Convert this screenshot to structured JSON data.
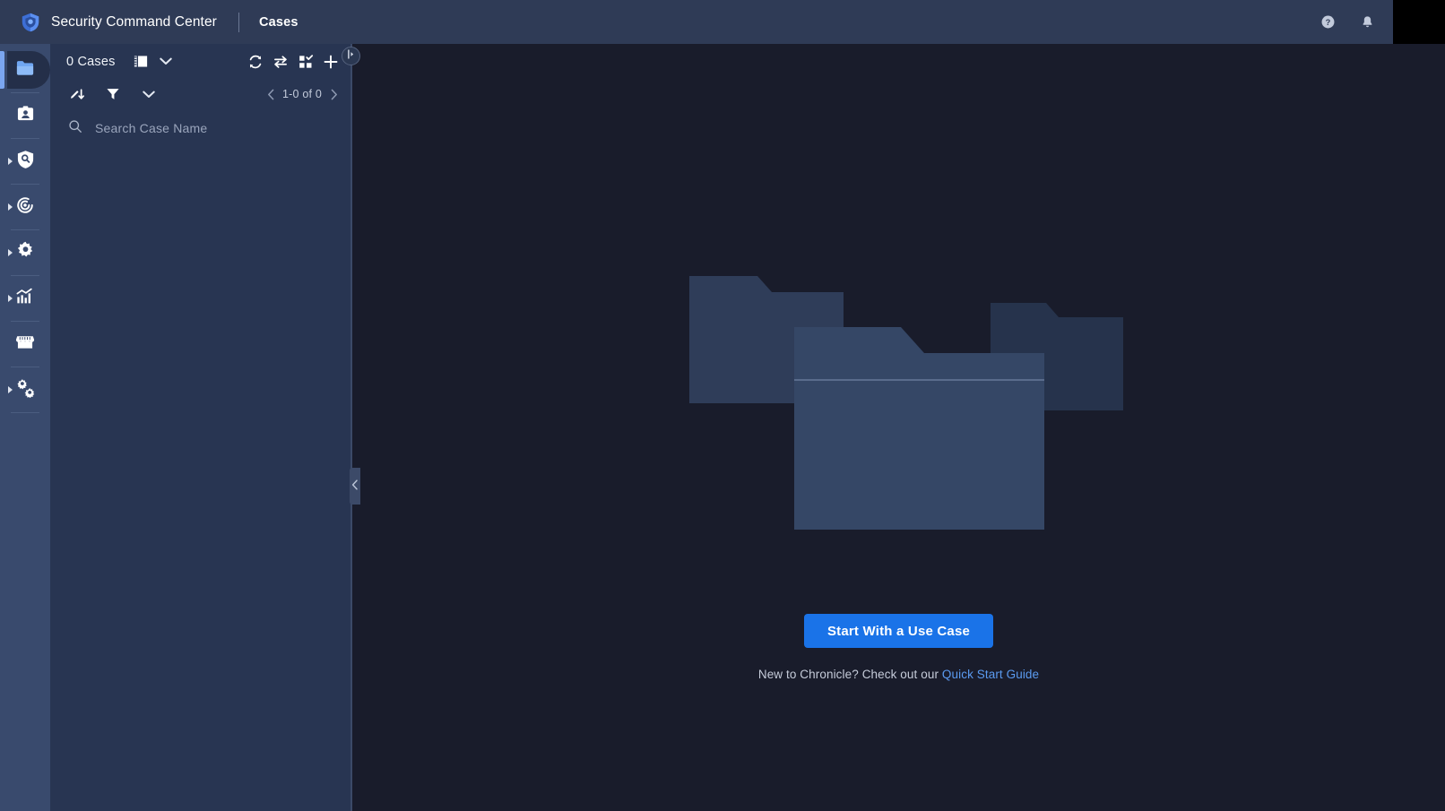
{
  "header": {
    "brand_title": "Security Command Center",
    "page_name": "Cases",
    "help_icon": "help-circle-icon",
    "bell_icon": "notification-bell-icon",
    "avatar": "profile-avatar"
  },
  "sidebar": {
    "items": [
      {
        "id": "cases",
        "icon": "folder-icon",
        "active": true,
        "expandable": false
      },
      {
        "id": "my-workdesk",
        "icon": "id-badge-icon",
        "active": false,
        "expandable": false
      },
      {
        "id": "detection",
        "icon": "shield-search-icon",
        "active": false,
        "expandable": true
      },
      {
        "id": "response",
        "icon": "radar-target-icon",
        "active": false,
        "expandable": true
      },
      {
        "id": "settings",
        "icon": "gear-icon",
        "active": false,
        "expandable": true
      },
      {
        "id": "reports",
        "icon": "bar-chart-icon",
        "active": false,
        "expandable": true
      },
      {
        "id": "marketplace",
        "icon": "storefront-icon",
        "active": false,
        "expandable": false
      },
      {
        "id": "integrations",
        "icon": "gears-config-icon",
        "active": false,
        "expandable": true
      }
    ]
  },
  "cases_panel": {
    "count_label": "0 Cases",
    "view_icon": "view-layout-icon",
    "view_caret_icon": "chevron-down-icon",
    "actions": [
      {
        "id": "refresh",
        "icon": "refresh-icon"
      },
      {
        "id": "transfer",
        "icon": "swap-arrows-icon"
      },
      {
        "id": "bulk",
        "icon": "grid-check-icon"
      },
      {
        "id": "add-case",
        "icon": "plus-icon"
      }
    ],
    "sort_icon": "sort-descending-icon",
    "filter_icon": "filter-funnel-icon",
    "filter_caret_icon": "chevron-down-icon",
    "pagination": {
      "prev_icon": "chevron-left-icon",
      "label": "1-0 of 0",
      "next_icon": "chevron-right-icon"
    },
    "search": {
      "icon": "search-icon",
      "placeholder": "Search Case Name",
      "value": ""
    }
  },
  "divider": {
    "top_handle_icon": "expand-panel-icon",
    "mid_handle_icon": "chevron-left-icon"
  },
  "empty_state": {
    "illustration": "empty-folders-illustration",
    "cta_label": "Start With a Use Case",
    "hint_prefix": "New to Chronicle? Check out our ",
    "hint_link": "Quick Start Guide"
  },
  "colors": {
    "header_bg": "#2f3b56",
    "rail_bg": "#394a6d",
    "panel_bg": "#283552",
    "main_bg": "#191c2b",
    "accent_blue": "#1a73e8",
    "link_blue": "#5b9bf0",
    "folder_front": "#354766",
    "folder_back_left": "#2f3d59",
    "folder_back_right": "#283consisting"
  }
}
